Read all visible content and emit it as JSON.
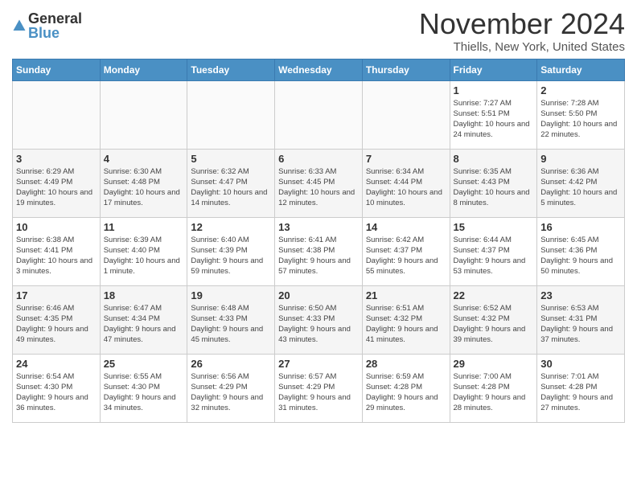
{
  "header": {
    "logo_general": "General",
    "logo_blue": "Blue",
    "month_title": "November 2024",
    "subtitle": "Thiells, New York, United States"
  },
  "days_of_week": [
    "Sunday",
    "Monday",
    "Tuesday",
    "Wednesday",
    "Thursday",
    "Friday",
    "Saturday"
  ],
  "weeks": [
    [
      {
        "day": "",
        "info": ""
      },
      {
        "day": "",
        "info": ""
      },
      {
        "day": "",
        "info": ""
      },
      {
        "day": "",
        "info": ""
      },
      {
        "day": "",
        "info": ""
      },
      {
        "day": "1",
        "info": "Sunrise: 7:27 AM\nSunset: 5:51 PM\nDaylight: 10 hours and 24 minutes."
      },
      {
        "day": "2",
        "info": "Sunrise: 7:28 AM\nSunset: 5:50 PM\nDaylight: 10 hours and 22 minutes."
      }
    ],
    [
      {
        "day": "3",
        "info": "Sunrise: 6:29 AM\nSunset: 4:49 PM\nDaylight: 10 hours and 19 minutes."
      },
      {
        "day": "4",
        "info": "Sunrise: 6:30 AM\nSunset: 4:48 PM\nDaylight: 10 hours and 17 minutes."
      },
      {
        "day": "5",
        "info": "Sunrise: 6:32 AM\nSunset: 4:47 PM\nDaylight: 10 hours and 14 minutes."
      },
      {
        "day": "6",
        "info": "Sunrise: 6:33 AM\nSunset: 4:45 PM\nDaylight: 10 hours and 12 minutes."
      },
      {
        "day": "7",
        "info": "Sunrise: 6:34 AM\nSunset: 4:44 PM\nDaylight: 10 hours and 10 minutes."
      },
      {
        "day": "8",
        "info": "Sunrise: 6:35 AM\nSunset: 4:43 PM\nDaylight: 10 hours and 8 minutes."
      },
      {
        "day": "9",
        "info": "Sunrise: 6:36 AM\nSunset: 4:42 PM\nDaylight: 10 hours and 5 minutes."
      }
    ],
    [
      {
        "day": "10",
        "info": "Sunrise: 6:38 AM\nSunset: 4:41 PM\nDaylight: 10 hours and 3 minutes."
      },
      {
        "day": "11",
        "info": "Sunrise: 6:39 AM\nSunset: 4:40 PM\nDaylight: 10 hours and 1 minute."
      },
      {
        "day": "12",
        "info": "Sunrise: 6:40 AM\nSunset: 4:39 PM\nDaylight: 9 hours and 59 minutes."
      },
      {
        "day": "13",
        "info": "Sunrise: 6:41 AM\nSunset: 4:38 PM\nDaylight: 9 hours and 57 minutes."
      },
      {
        "day": "14",
        "info": "Sunrise: 6:42 AM\nSunset: 4:37 PM\nDaylight: 9 hours and 55 minutes."
      },
      {
        "day": "15",
        "info": "Sunrise: 6:44 AM\nSunset: 4:37 PM\nDaylight: 9 hours and 53 minutes."
      },
      {
        "day": "16",
        "info": "Sunrise: 6:45 AM\nSunset: 4:36 PM\nDaylight: 9 hours and 50 minutes."
      }
    ],
    [
      {
        "day": "17",
        "info": "Sunrise: 6:46 AM\nSunset: 4:35 PM\nDaylight: 9 hours and 49 minutes."
      },
      {
        "day": "18",
        "info": "Sunrise: 6:47 AM\nSunset: 4:34 PM\nDaylight: 9 hours and 47 minutes."
      },
      {
        "day": "19",
        "info": "Sunrise: 6:48 AM\nSunset: 4:33 PM\nDaylight: 9 hours and 45 minutes."
      },
      {
        "day": "20",
        "info": "Sunrise: 6:50 AM\nSunset: 4:33 PM\nDaylight: 9 hours and 43 minutes."
      },
      {
        "day": "21",
        "info": "Sunrise: 6:51 AM\nSunset: 4:32 PM\nDaylight: 9 hours and 41 minutes."
      },
      {
        "day": "22",
        "info": "Sunrise: 6:52 AM\nSunset: 4:32 PM\nDaylight: 9 hours and 39 minutes."
      },
      {
        "day": "23",
        "info": "Sunrise: 6:53 AM\nSunset: 4:31 PM\nDaylight: 9 hours and 37 minutes."
      }
    ],
    [
      {
        "day": "24",
        "info": "Sunrise: 6:54 AM\nSunset: 4:30 PM\nDaylight: 9 hours and 36 minutes."
      },
      {
        "day": "25",
        "info": "Sunrise: 6:55 AM\nSunset: 4:30 PM\nDaylight: 9 hours and 34 minutes."
      },
      {
        "day": "26",
        "info": "Sunrise: 6:56 AM\nSunset: 4:29 PM\nDaylight: 9 hours and 32 minutes."
      },
      {
        "day": "27",
        "info": "Sunrise: 6:57 AM\nSunset: 4:29 PM\nDaylight: 9 hours and 31 minutes."
      },
      {
        "day": "28",
        "info": "Sunrise: 6:59 AM\nSunset: 4:28 PM\nDaylight: 9 hours and 29 minutes."
      },
      {
        "day": "29",
        "info": "Sunrise: 7:00 AM\nSunset: 4:28 PM\nDaylight: 9 hours and 28 minutes."
      },
      {
        "day": "30",
        "info": "Sunrise: 7:01 AM\nSunset: 4:28 PM\nDaylight: 9 hours and 27 minutes."
      }
    ]
  ]
}
